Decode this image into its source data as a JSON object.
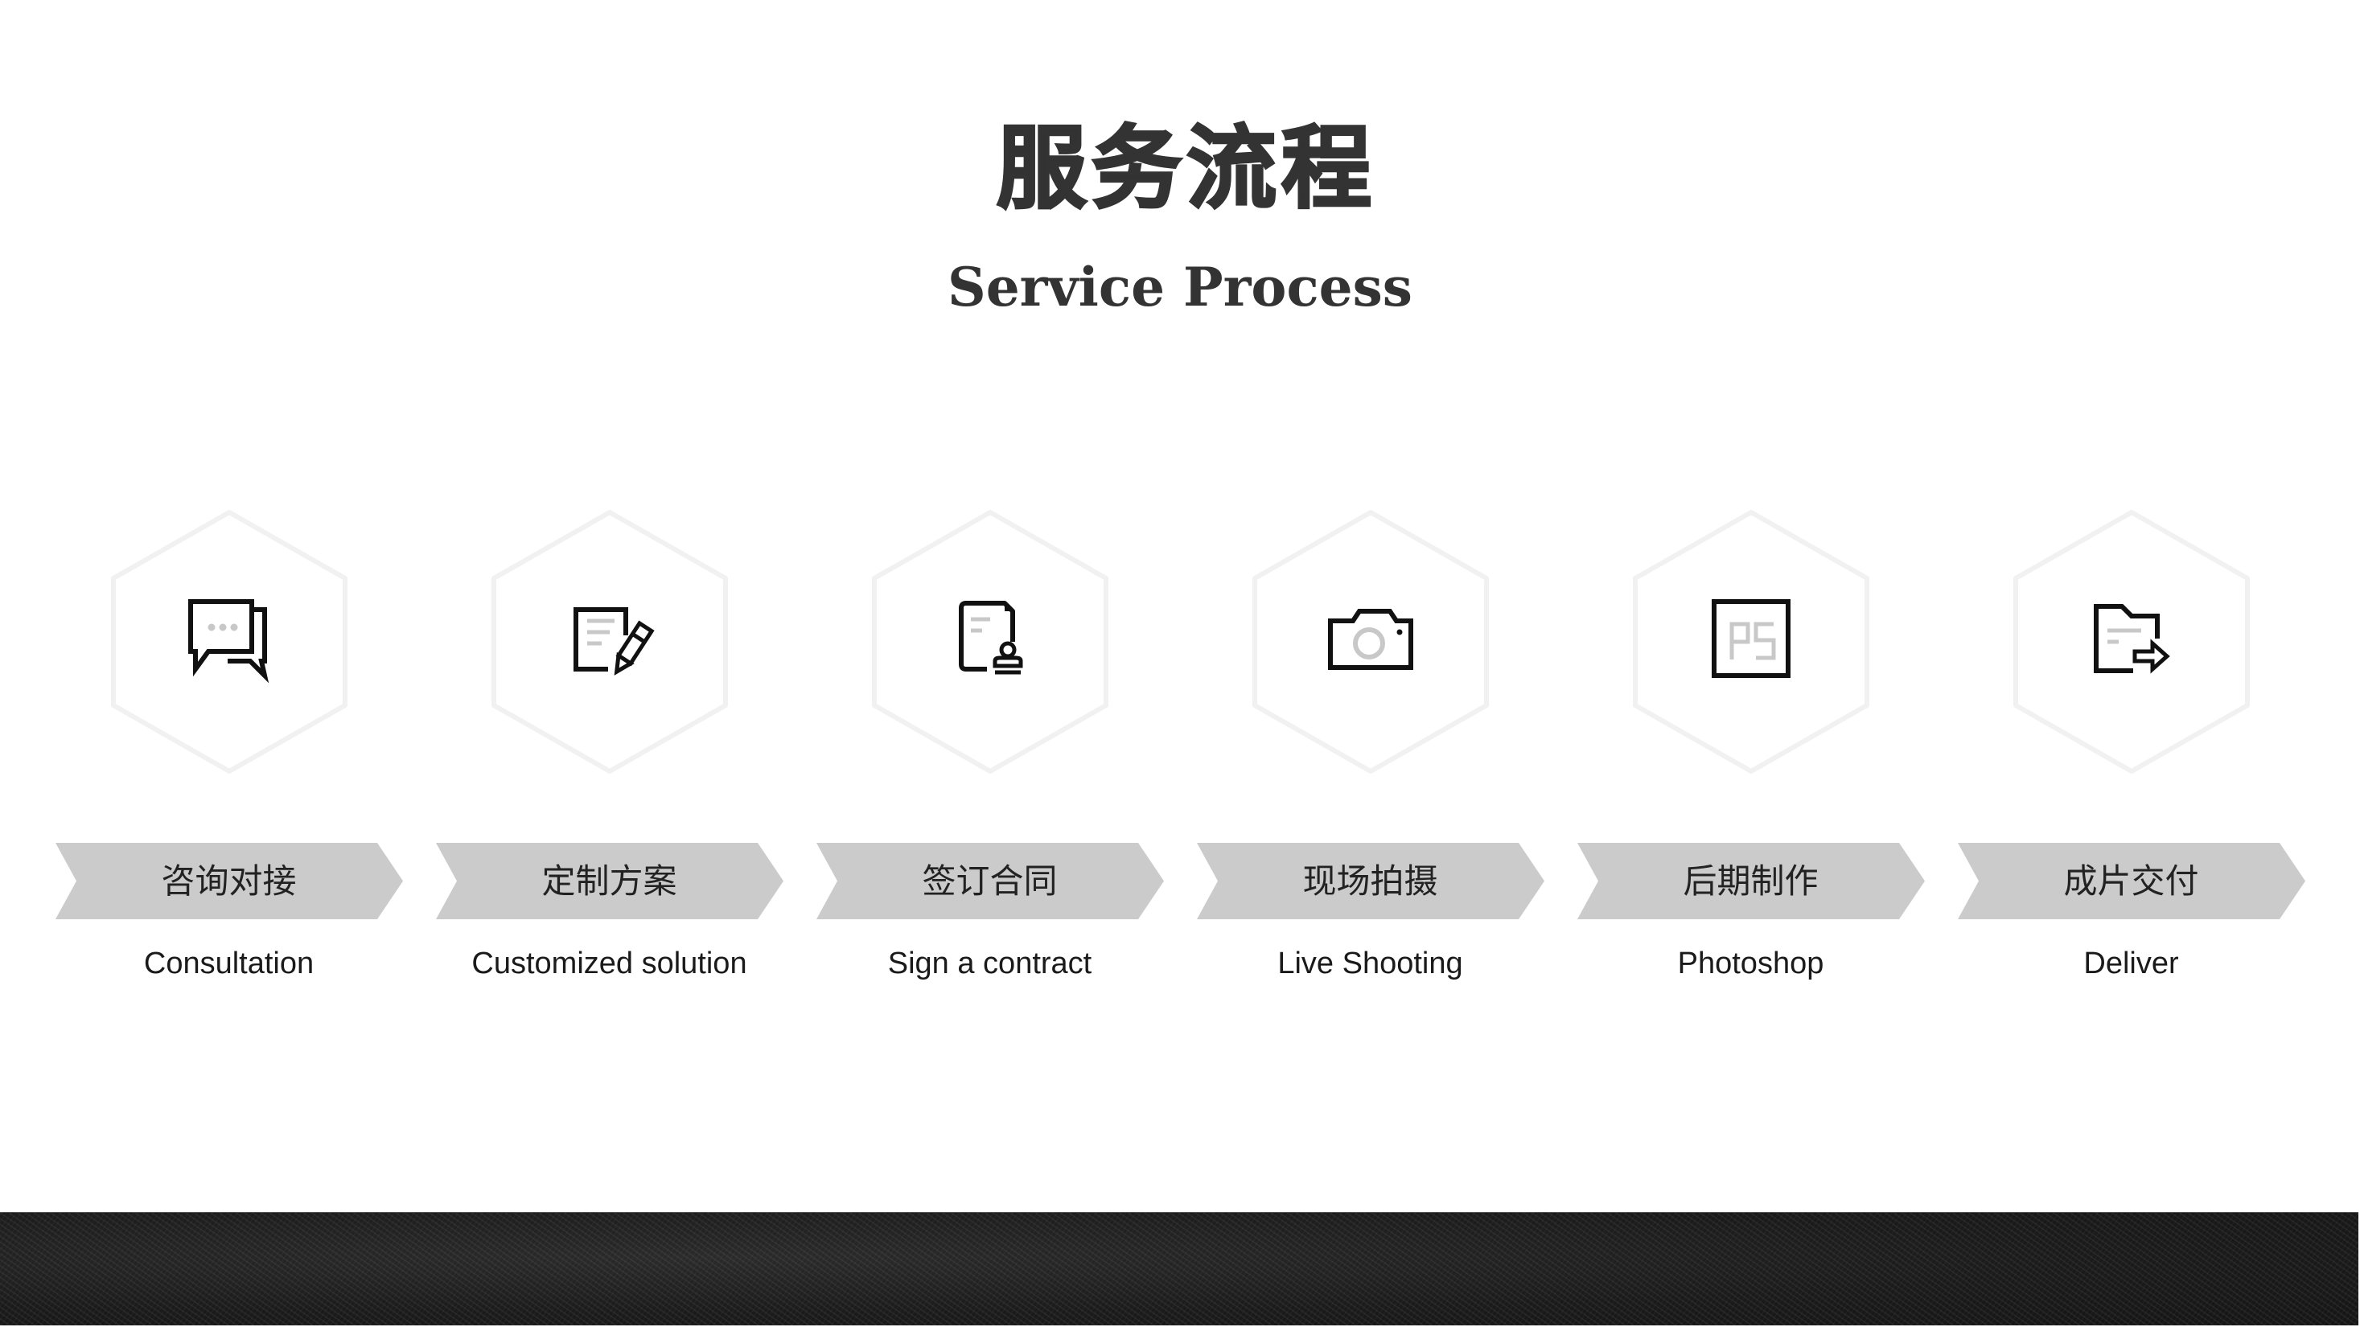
{
  "header": {
    "title_cn": "服务流程",
    "title_en": "Service Process"
  },
  "colors": {
    "banner_fill": "#cbcbcb",
    "title_text": "#333333",
    "icon_stroke": "#111111",
    "icon_accent": "#c8c8c8",
    "footer_band": "#1c1c1c"
  },
  "steps": [
    {
      "icon": "chat-bubbles-icon",
      "label_cn": "咨询对接",
      "label_en": "Consultation"
    },
    {
      "icon": "document-edit-icon",
      "label_cn": "定制方案",
      "label_en": "Customized solution"
    },
    {
      "icon": "contract-stamp-icon",
      "label_cn": "签订合同",
      "label_en": "Sign a contract"
    },
    {
      "icon": "camera-icon",
      "label_cn": "现场拍摄",
      "label_en": "Live Shooting"
    },
    {
      "icon": "photoshop-icon",
      "label_cn": "后期制作",
      "label_en": "Photoshop"
    },
    {
      "icon": "folder-send-icon",
      "label_cn": "成片交付",
      "label_en": "Deliver"
    }
  ]
}
